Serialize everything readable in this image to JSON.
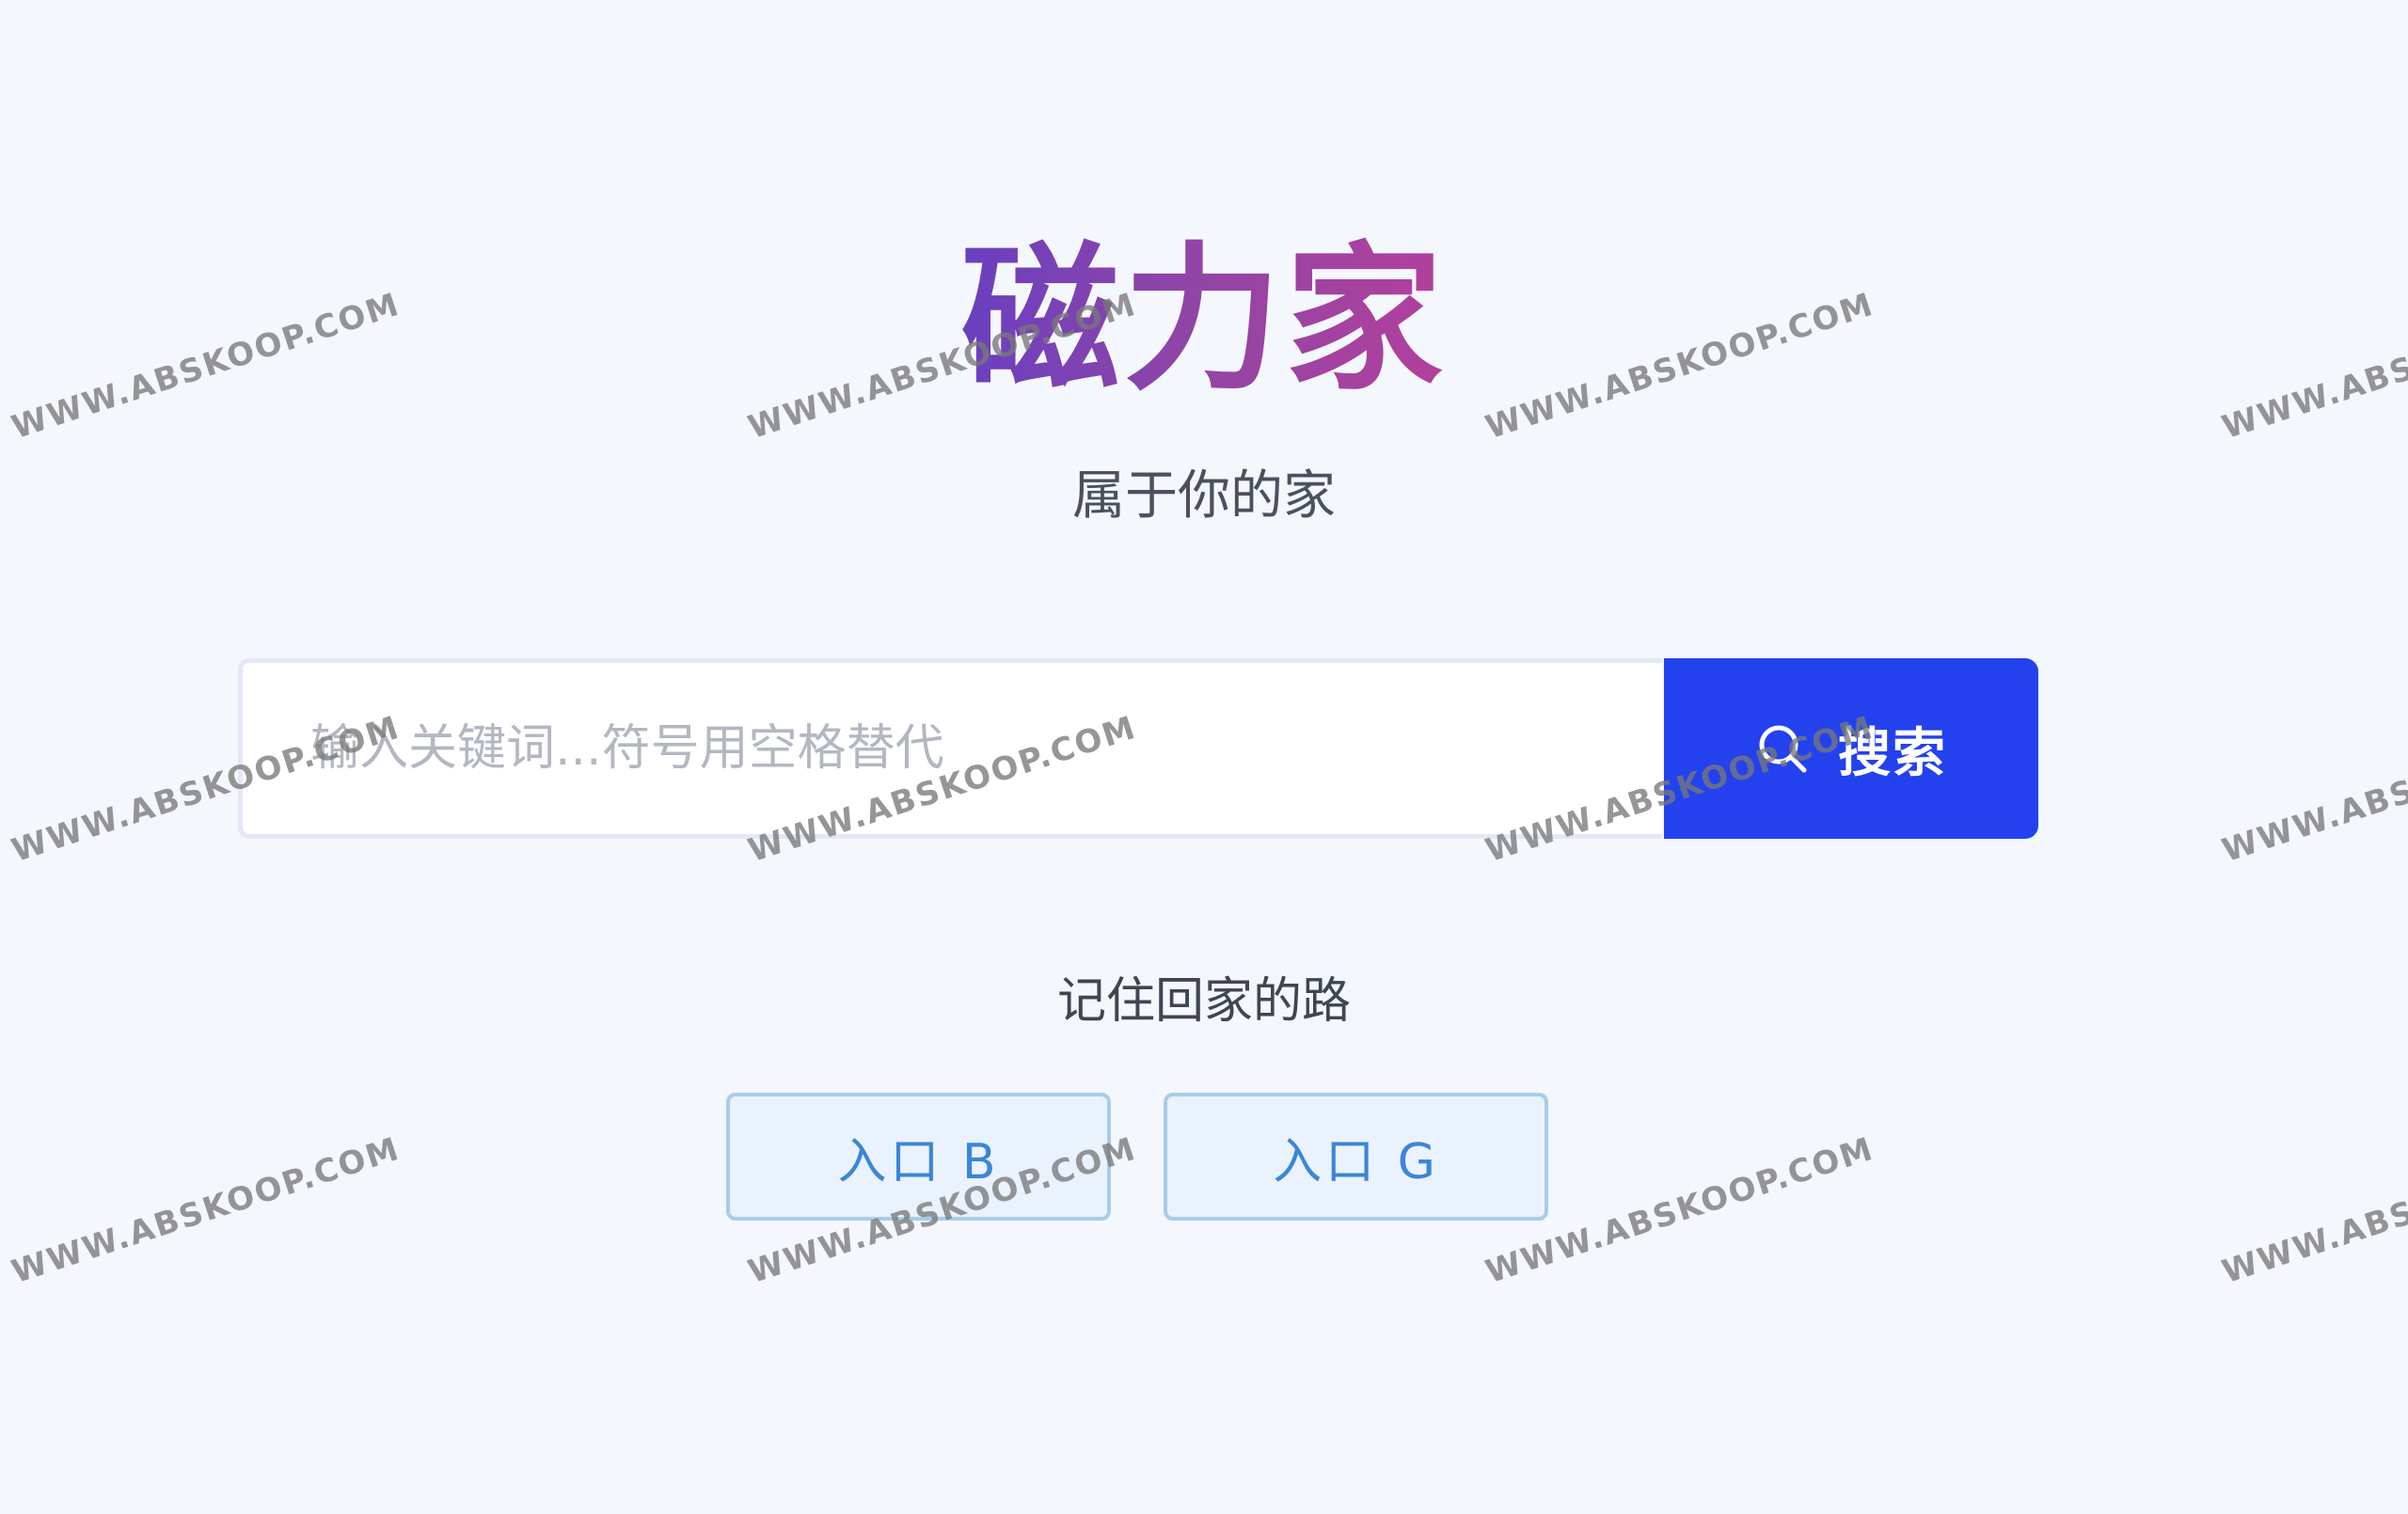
{
  "logo": {
    "text": "磁力家"
  },
  "subtitle": "属于你的家",
  "search": {
    "placeholder": "输入关键词...符号用空格替代",
    "value": "",
    "button_label": "搜索",
    "button_icon": "search-icon"
  },
  "entries": {
    "title": "记住回家的路",
    "items": [
      {
        "label": "入口 B"
      },
      {
        "label": "入口 G"
      }
    ]
  },
  "watermark": {
    "text": "WWW.ABSKOOP.COM"
  },
  "colors": {
    "background": "#f4f7fc",
    "logo_gradient_start": "#6a3fc0",
    "logo_gradient_end": "#b2409c",
    "search_button": "#2342ee",
    "entry_text": "#3a86d6",
    "entry_border": "#a9cce8",
    "entry_background": "#eaf2fd"
  }
}
